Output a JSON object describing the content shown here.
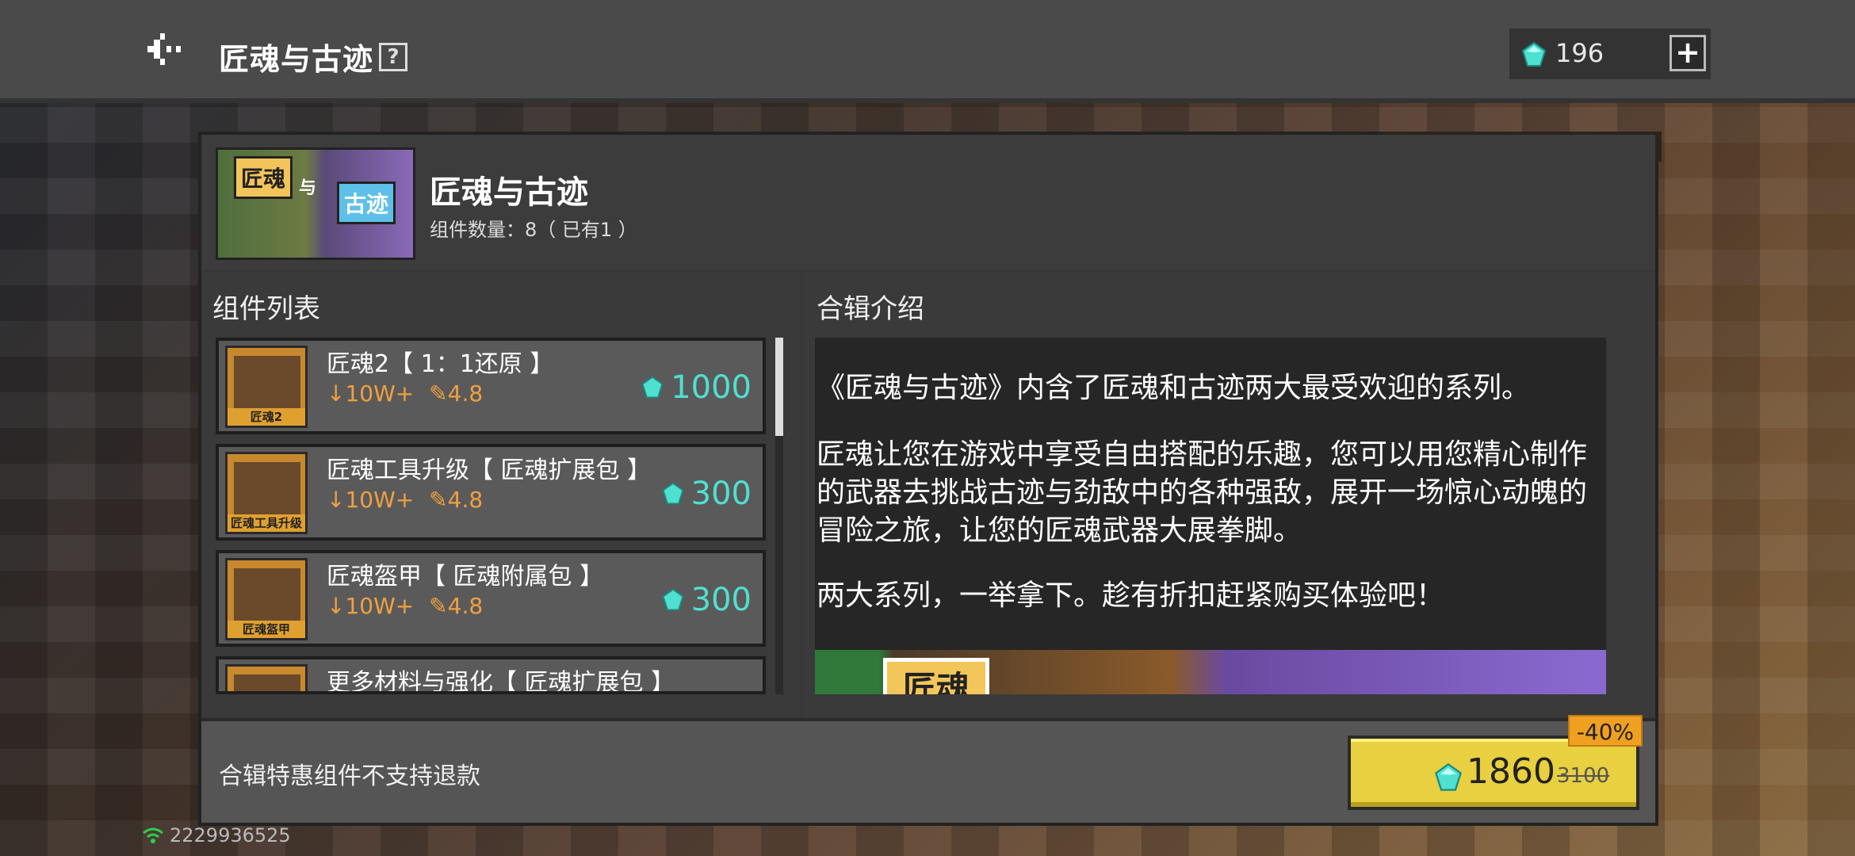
{
  "header": {
    "title": "匠魂与古迹",
    "help_glyph": "?",
    "currency_amount": "196",
    "add_label": "+"
  },
  "bundle": {
    "title": "匠魂与古迹",
    "count_text": "组件数量：8（ 已有1 ）",
    "thumb_tag1": "匠魂",
    "thumb_joiner": "与",
    "thumb_tag2": "古迹"
  },
  "list": {
    "label": "组件列表",
    "items": [
      {
        "name": "匠魂2【 1：1还原 】",
        "downloads": "10W+",
        "rating": "4.8",
        "price": "1000",
        "icon_caption": "匠魂2"
      },
      {
        "name": "匠魂工具升级【 匠魂扩展包 】",
        "downloads": "10W+",
        "rating": "4.8",
        "price": "300",
        "icon_caption": "匠魂工具升级"
      },
      {
        "name": "匠魂盔甲【 匠魂附属包 】",
        "downloads": "10W+",
        "rating": "4.8",
        "price": "300",
        "icon_caption": "匠魂盔甲"
      },
      {
        "name": "更多材料与强化【 匠魂扩展包 】",
        "downloads": "",
        "rating": "",
        "price": "",
        "icon_caption": ""
      }
    ]
  },
  "description": {
    "label": "合辑介绍",
    "paragraphs": [
      "《匠魂与古迹》内含了匠魂和古迹两大最受欢迎的系列。",
      "匠魂让您在游戏中享受自由搭配的乐趣，您可以用您精心制作的武器去挑战古迹与劲敌中的各种强敌，展开一场惊心动魄的冒险之旅，让您的匠魂武器大展拳脚。",
      "两大系列，一举拿下。趁有折扣赶紧购买体验吧！"
    ],
    "banner_word": "匠魂"
  },
  "footer": {
    "refund_note": "合辑特惠组件不支持退款",
    "price": "1860",
    "old_price": "3100",
    "discount": "-40%"
  },
  "status": {
    "player_id": "2229936525"
  },
  "colors": {
    "accent_green": "#1db954",
    "buy_yellow": "#e8d040",
    "gem_cyan": "#4fe0d0",
    "discount_orange": "#f0a020"
  },
  "icons": [
    "back-icon",
    "help-icon",
    "gem-icon",
    "plus-icon",
    "download-icon",
    "rating-icon",
    "signal-icon"
  ]
}
